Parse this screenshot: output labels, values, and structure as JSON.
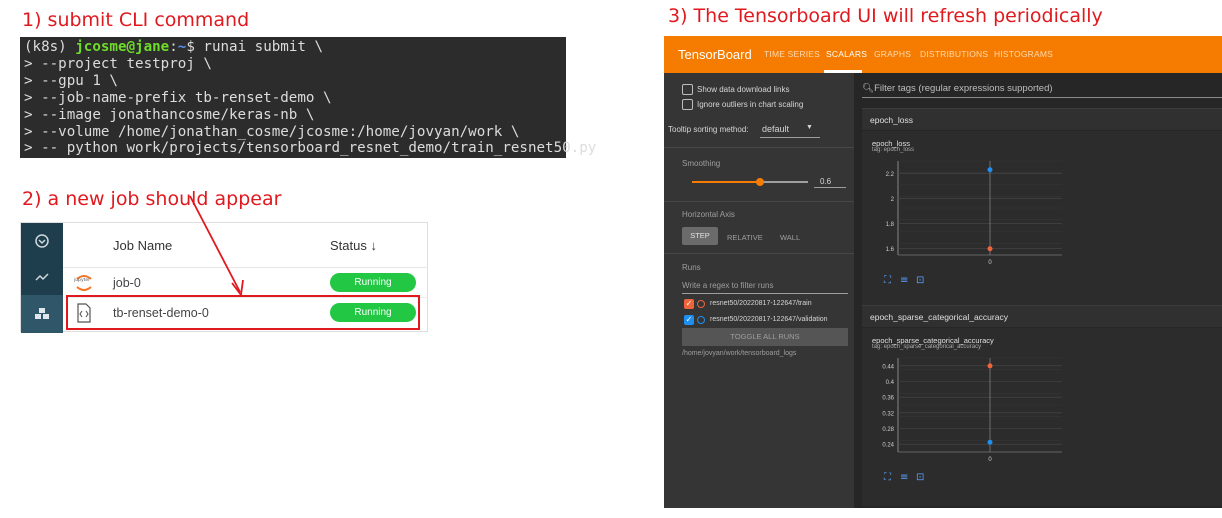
{
  "steps": {
    "step1": "1) submit CLI command",
    "step2": "2) a new job should appear",
    "step3": "3) The Tensorboard UI will refresh periodically"
  },
  "terminal": {
    "prompt_env": "(k8s) ",
    "prompt_user": "jcosme@jane",
    "prompt_sep": ":",
    "prompt_path": "~",
    "prompt_end": "$ ",
    "first_command": "runai submit \\",
    "lines": [
      "> --project testproj \\",
      "> --gpu 1 \\",
      "> --job-name-prefix tb-renset-demo \\",
      "> --image jonathancosme/keras-nb \\",
      "> --volume /home/jonathan_cosme/jcosme:/home/jovyan/work \\",
      "> -- python work/projects/tensorboard_resnet_demo/train_resnet50.py"
    ]
  },
  "jobs": {
    "col_name": "Job Name",
    "col_status": "Status",
    "rows": [
      {
        "name": "job-0",
        "status": "Running",
        "icon": "jupyter-icon",
        "icon_text": "jupyter"
      },
      {
        "name": "tb-renset-demo-0",
        "status": "Running",
        "icon": "file-code-icon"
      }
    ],
    "rail_icons": [
      "dashboard-icon",
      "trend-icon",
      "jobs-icon"
    ],
    "status_color": "#22c744"
  },
  "tensorboard": {
    "brand": "TensorBoard",
    "tabs": [
      "TIME SERIES",
      "SCALARS",
      "GRAPHS",
      "DISTRIBUTIONS",
      "HISTOGRAMS"
    ],
    "active_tab": "SCALARS",
    "accent": "#f57c00",
    "sidebar": {
      "show_download": "Show data download links",
      "ignore_outliers": "Ignore outliers in chart scaling",
      "tooltip_label": "Tooltip sorting method:",
      "tooltip_value": "default",
      "smoothing_label": "Smoothing",
      "smoothing_value": "0.6",
      "haxis_label": "Horizontal Axis",
      "haxis_options": [
        "STEP",
        "RELATIVE",
        "WALL"
      ],
      "runs_label": "Runs",
      "runs_filter_placeholder": "Write a regex to filter runs",
      "runs": [
        {
          "name": "resnet50/20220817-122647/train",
          "color": "#f0643c"
        },
        {
          "name": "resnet50/20220817-122647/validation",
          "color": "#1f8ff0"
        }
      ],
      "toggle_all": "TOGGLE ALL RUNS",
      "logdir": "/home/jovyan/work/tensorboard_logs"
    },
    "main": {
      "filter_placeholder": "Filter tags (regular expressions supported)",
      "groups": [
        {
          "header": "epoch_loss",
          "card_title": "epoch_loss",
          "card_tag": "tag: epoch_loss",
          "yticks": [
            "2.2",
            "2",
            "1.8",
            "1.6"
          ],
          "xtick": "0"
        },
        {
          "header": "epoch_sparse_categorical_accuracy",
          "card_title": "epoch_sparse_categorical_accuracy",
          "card_tag": "tag: epoch_sparse_categorical_accuracy",
          "yticks": [
            "0.44",
            "0.4",
            "0.36",
            "0.32",
            "0.28",
            "0.24"
          ],
          "xtick": "0"
        }
      ]
    }
  },
  "chart_data": [
    {
      "type": "scatter",
      "title": "epoch_loss",
      "ylim": [
        1.55,
        2.3
      ],
      "series": [
        {
          "name": "resnet50/20220817-122647/train",
          "x": [
            0
          ],
          "y": [
            1.6
          ],
          "color": "#f0643c"
        },
        {
          "name": "resnet50/20220817-122647/validation",
          "x": [
            0
          ],
          "y": [
            2.23
          ],
          "color": "#1f8ff0"
        }
      ]
    },
    {
      "type": "scatter",
      "title": "epoch_sparse_categorical_accuracy",
      "ylim": [
        0.22,
        0.46
      ],
      "series": [
        {
          "name": "resnet50/20220817-122647/train",
          "x": [
            0
          ],
          "y": [
            0.44
          ],
          "color": "#f0643c"
        },
        {
          "name": "resnet50/20220817-122647/validation",
          "x": [
            0
          ],
          "y": [
            0.245
          ],
          "color": "#1f8ff0"
        }
      ]
    }
  ]
}
